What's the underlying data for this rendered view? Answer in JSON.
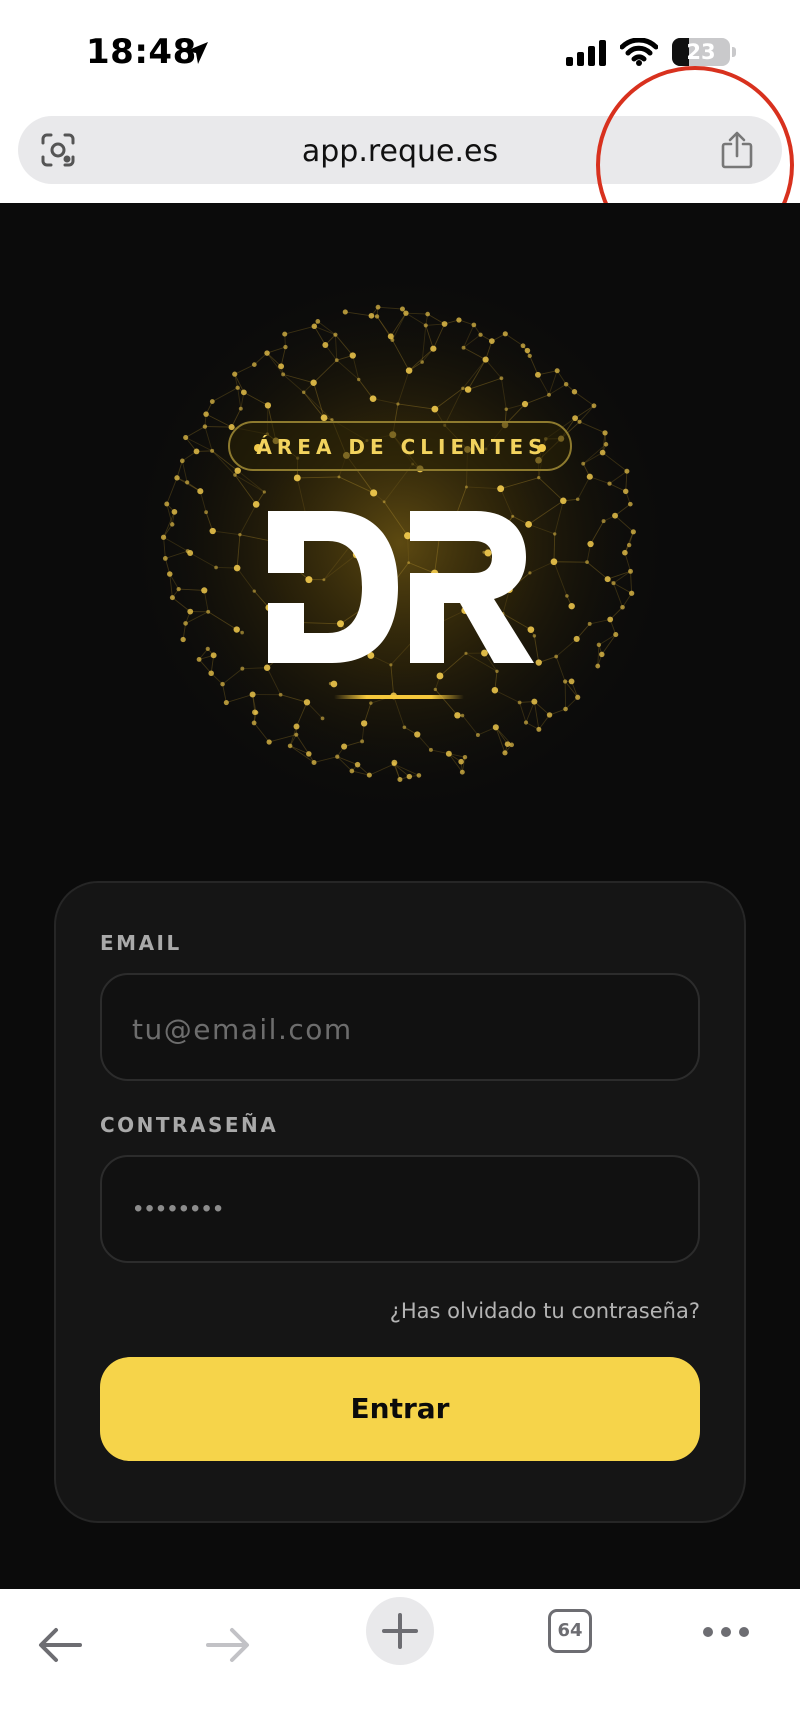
{
  "status_bar": {
    "time": "18:48",
    "battery_level": "23",
    "icons": [
      "location-arrow-icon",
      "cellular-signal-icon",
      "wifi-icon",
      "battery-icon"
    ]
  },
  "browser": {
    "url": "app.reque.es",
    "left_icon": "visual-search-icon",
    "right_icon": "share-icon",
    "tab_count": "64",
    "toolbar_icons": [
      "back-arrow-icon",
      "forward-arrow-icon",
      "new-tab-plus-icon",
      "tab-switcher-icon",
      "more-dots-icon"
    ]
  },
  "hero": {
    "badge_text": "ÁREA DE CLIENTES",
    "logo_name": "DR",
    "accent_color": "#f6d44a"
  },
  "login": {
    "email_label": "EMAIL",
    "email_placeholder": "tu@email.com",
    "password_label": "CONTRASEÑA",
    "password_mask": "••••••••",
    "forgot_link": "¿Has olvidado tu contraseña?",
    "submit_label": "Entrar"
  },
  "colors": {
    "background": "#0b0b0b",
    "card": "#151515",
    "gold": "#f2d35e",
    "annotation": "#d8311e"
  }
}
